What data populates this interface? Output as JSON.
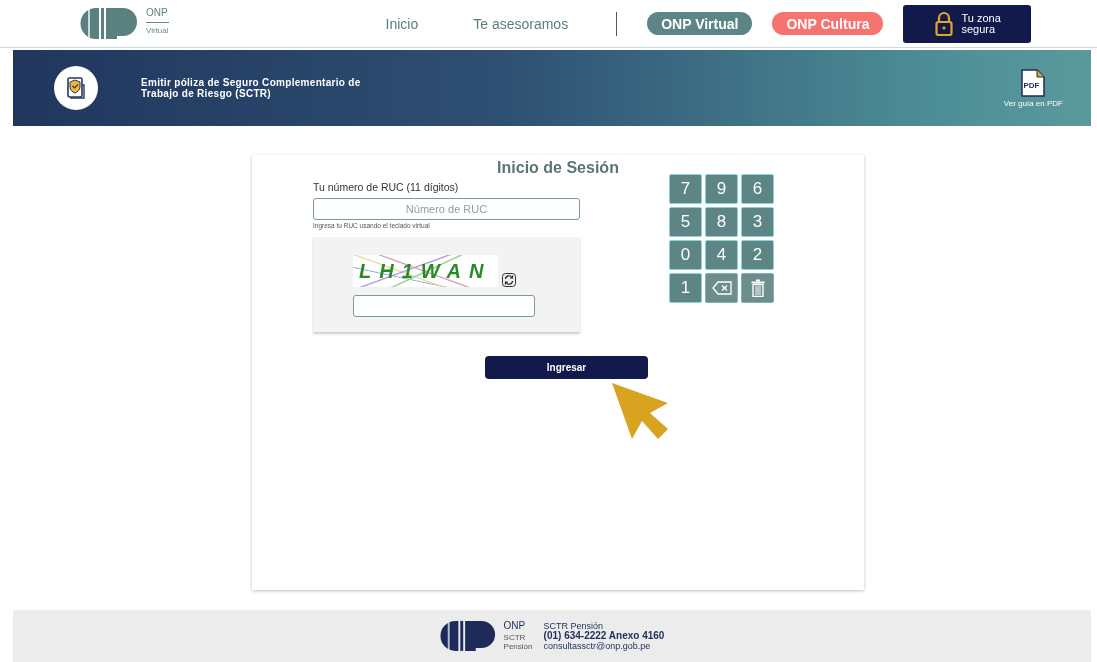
{
  "header": {
    "logo": {
      "name": "ONP",
      "sub": "Virtual"
    },
    "nav": [
      {
        "label": "Inicio"
      },
      {
        "label": "Te asesoramos"
      }
    ],
    "buttons": [
      {
        "label": "ONP Virtual",
        "kind": "teal"
      },
      {
        "label": "ONP Cultura",
        "kind": "coral"
      },
      {
        "label": "Tu zona segura",
        "kind": "secure"
      }
    ]
  },
  "banner": {
    "title": "Emitir póliza de Seguro Complementario de Trabajo de Riesgo (SCTR)",
    "pdf_label": "Ver guía en PDF",
    "pdf_icon_text": "PDF"
  },
  "login": {
    "title": "Inicio de Sesión",
    "ruc_label": "Tu número de RUC (11 dígitos)",
    "ruc_placeholder": "Número de RUC",
    "hint": "Ingresa tu RUC usando el teclado virtual",
    "captcha_text": "LH1WAN",
    "submit": "Ingresar",
    "keypad": [
      {
        "kind": "digit",
        "label": "7"
      },
      {
        "kind": "digit",
        "label": "9"
      },
      {
        "kind": "digit",
        "label": "6"
      },
      {
        "kind": "digit",
        "label": "5"
      },
      {
        "kind": "digit",
        "label": "8"
      },
      {
        "kind": "digit",
        "label": "3"
      },
      {
        "kind": "digit",
        "label": "0"
      },
      {
        "kind": "digit",
        "label": "4"
      },
      {
        "kind": "digit",
        "label": "2"
      },
      {
        "kind": "digit",
        "label": "1"
      },
      {
        "kind": "backspace"
      },
      {
        "kind": "clear"
      }
    ]
  },
  "footer": {
    "logo": {
      "name": "ONP",
      "sub": "SCTR Pensión"
    },
    "title": "SCTR Pensión",
    "phone": "(01) 634-2222 Anexo 4160",
    "email": "consultassctr@onp.gob.pe"
  }
}
